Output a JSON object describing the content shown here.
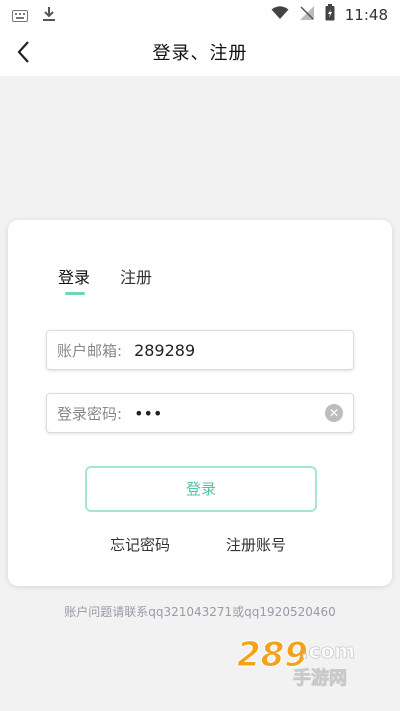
{
  "statusbar": {
    "time": "11:48"
  },
  "header": {
    "title": "登录、注册"
  },
  "tabs": [
    {
      "label": "登录",
      "active": true
    },
    {
      "label": "注册",
      "active": false
    }
  ],
  "form": {
    "email_label": "账户邮箱:",
    "email_value": "289289",
    "password_label": "登录密码:",
    "password_value": "•••"
  },
  "actions": {
    "login_label": "登录",
    "forgot_label": "忘记密码",
    "register_label": "注册账号"
  },
  "footer": {
    "contact_text": "账户问题请联系qq321043271或qq1920520460"
  },
  "watermark": {
    "text": "289.com 手游网"
  },
  "colors": {
    "accent": "#6fd6b8",
    "button_border": "#a7e5d3",
    "button_text": "#53c4a3"
  }
}
